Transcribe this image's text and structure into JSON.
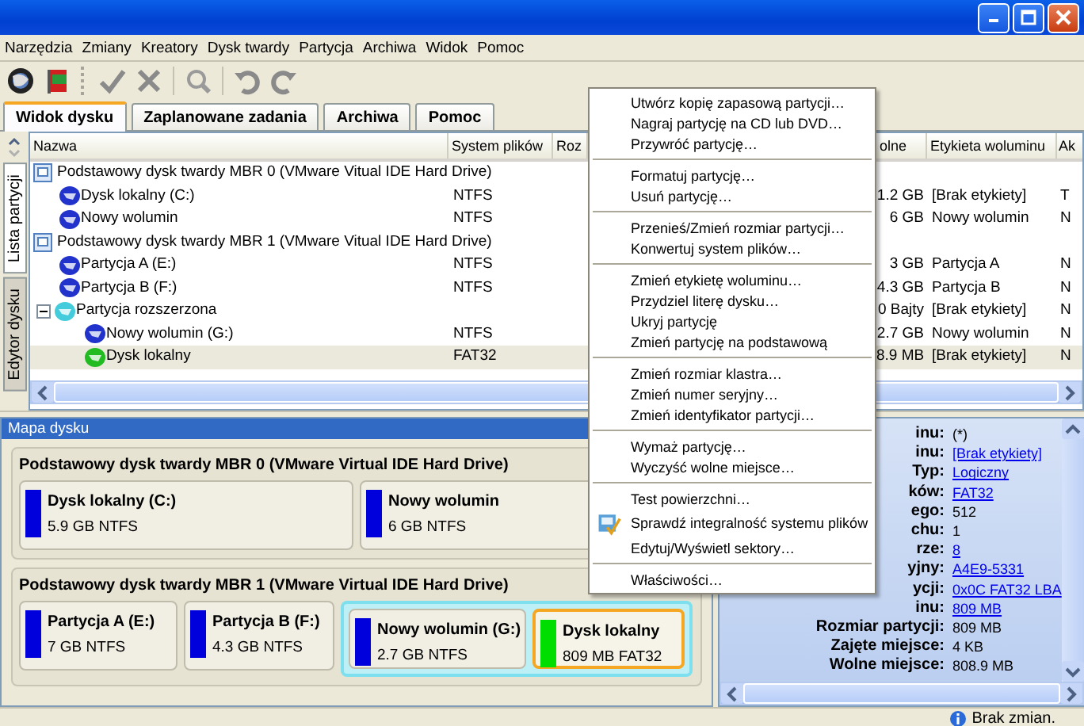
{
  "menu_bar": [
    "Narzędzia",
    "Zmiany",
    "Kreatory",
    "Dysk twardy",
    "Partycja",
    "Archiwa",
    "Widok",
    "Pomoc"
  ],
  "tabs": [
    {
      "label": "Widok dysku",
      "selected": true
    },
    {
      "label": "Zaplanowane zadania",
      "selected": false
    },
    {
      "label": "Archiwa",
      "selected": false
    },
    {
      "label": "Pomoc",
      "selected": false
    }
  ],
  "side_tabs": [
    {
      "label": "Lista partycji",
      "selected": true
    },
    {
      "label": "Edytor dysku",
      "selected": false
    }
  ],
  "table": {
    "columns": [
      "Nazwa",
      "System plików",
      "Roz",
      "olne",
      "Etykieta woluminu",
      "Ak"
    ],
    "rows": [
      {
        "kind": "disk",
        "name": "Podstawowy dysk twardy MBR 0 (VMware Vitual IDE Hard Drive)",
        "selected": false,
        "children": [
          {
            "kind": "partition",
            "name": "Dysk lokalny (C:)",
            "fs": "NTFS",
            "free": "1.2 GB",
            "label": "[Brak etykiety]",
            "active": "T",
            "color": "#2233cc",
            "selected": false
          },
          {
            "kind": "partition",
            "name": "Nowy wolumin",
            "fs": "NTFS",
            "free": "6 GB",
            "label": "Nowy wolumin",
            "active": "N",
            "color": "#2233cc",
            "selected": false
          }
        ]
      },
      {
        "kind": "disk",
        "name": "Podstawowy dysk twardy MBR 1 (VMware Vitual IDE Hard Drive)",
        "selected": false,
        "children": [
          {
            "kind": "partition",
            "name": "Partycja A (E:)",
            "fs": "NTFS",
            "free": "3 GB",
            "label": "Partycja A",
            "active": "N",
            "color": "#2233cc",
            "selected": false
          },
          {
            "kind": "partition",
            "name": "Partycja B (F:)",
            "fs": "NTFS",
            "free": "4.3 GB",
            "label": "Partycja B",
            "active": "N",
            "color": "#2233cc",
            "selected": false
          },
          {
            "kind": "partition",
            "name": "Partycja rozszerzona",
            "free": "0 Bajty",
            "label": "[Brak etykiety]",
            "active": "N",
            "color": "#44ccdd",
            "selected": false,
            "expanded": true,
            "children": [
              {
                "kind": "partition",
                "name": "Nowy wolumin (G:)",
                "fs": "NTFS",
                "free": "2.7 GB",
                "label": "Nowy wolumin",
                "active": "N",
                "color": "#2233cc",
                "selected": false
              },
              {
                "kind": "partition",
                "name": "Dysk lokalny",
                "fs": "FAT32",
                "free": "8.9 MB",
                "label": "[Brak etykiety]",
                "active": "N",
                "color": "#22bb22",
                "selected": true
              }
            ]
          }
        ]
      }
    ]
  },
  "disk_map": {
    "title": "Mapa dysku",
    "disks": [
      {
        "title": "Podstawowy dysk twardy MBR 0 (VMware Virtual IDE Hard Drive)",
        "partitions": [
          {
            "kind": "partition",
            "name": "Dysk lokalny (C:)",
            "info": "5.9 GB NTFS",
            "color": "#0000dd",
            "selected": false
          },
          {
            "kind": "partition",
            "name": "Nowy wolumin",
            "info": "6 GB NTFS",
            "color": "#0000dd",
            "selected": false
          }
        ]
      },
      {
        "title": "Podstawowy dysk twardy MBR 1 (VMware Virtual IDE Hard Drive)",
        "partitions": [
          {
            "kind": "partition",
            "name": "Partycja A (E:)",
            "info": "7 GB NTFS",
            "color": "#0000dd",
            "selected": false
          },
          {
            "kind": "partition",
            "name": "Partycja B (F:)",
            "info": "4.3 GB NTFS",
            "color": "#0000dd",
            "selected": false
          },
          {
            "kind": "extended",
            "partitions": [
              {
                "kind": "partition",
                "name": "Nowy wolumin (G:)",
                "info": "2.7 GB NTFS",
                "color": "#0000dd",
                "selected": false
              },
              {
                "kind": "partition",
                "name": "Dysk lokalny",
                "info": "809 MB FAT32",
                "color": "#00dd00",
                "selected": true
              }
            ]
          }
        ]
      }
    ]
  },
  "details": [
    {
      "label": "inu:",
      "value": "(*)",
      "link": false
    },
    {
      "label": "inu:",
      "value": "[Brak etykiety]",
      "link": true
    },
    {
      "label": "Typ:",
      "value": "Logiczny",
      "link": true
    },
    {
      "label": "ków:",
      "value": "FAT32",
      "link": true
    },
    {
      "label": "ego:",
      "value": "512",
      "link": false
    },
    {
      "label": "chu:",
      "value": "1",
      "link": false
    },
    {
      "label": "rze:",
      "value": "8",
      "link": true
    },
    {
      "label": "yjny:",
      "value": "A4E9-5331",
      "link": true
    },
    {
      "label": "ycji:",
      "value": "0x0C FAT32 LBA",
      "link": true
    },
    {
      "label": "inu:",
      "value": "809 MB",
      "link": true
    },
    {
      "label": "Rozmiar partycji:",
      "value": "809 MB",
      "link": false
    },
    {
      "label": "Zajęte miejsce:",
      "value": "4 KB",
      "link": false
    },
    {
      "label": "Wolne miejsce:",
      "value": "808.9 MB",
      "link": false
    }
  ],
  "context_menu": {
    "groups": [
      [
        {
          "kind": "plain",
          "label": "Utwórz kopię zapasową partycji…"
        },
        {
          "kind": "plain",
          "label": "Nagraj partycję na CD lub DVD…"
        },
        {
          "kind": "plain",
          "label": "Przywróć partycję…"
        }
      ],
      [
        {
          "kind": "plain",
          "label": "Formatuj partycję…"
        },
        {
          "kind": "plain",
          "label": "Usuń partycję…"
        }
      ],
      [
        {
          "kind": "plain",
          "label": "Przenieś/Zmień rozmiar partycji…"
        },
        {
          "kind": "plain",
          "label": "Konwertuj system plików…"
        }
      ],
      [
        {
          "kind": "plain",
          "label": "Zmień etykietę woluminu…"
        },
        {
          "kind": "plain",
          "label": "Przydziel literę dysku…"
        },
        {
          "kind": "plain",
          "label": "Ukryj partycję"
        },
        {
          "kind": "plain",
          "label": "Zmień partycję na podstawową"
        }
      ],
      [
        {
          "kind": "plain",
          "label": "Zmień rozmiar klastra…"
        },
        {
          "kind": "plain",
          "label": "Zmień numer seryjny…"
        },
        {
          "kind": "plain",
          "label": "Zmień identyfikator partycji…"
        }
      ],
      [
        {
          "kind": "plain",
          "label": "Wymaż partycję…"
        },
        {
          "kind": "plain",
          "label": "Wyczyść wolne miejsce…"
        }
      ],
      [
        {
          "kind": "plain",
          "label": "Test powierzchni…"
        },
        {
          "kind": "with-icon",
          "label": "Sprawdź integralność systemu plików"
        },
        {
          "kind": "plain",
          "label": "Edytuj/Wyświetl sektory…"
        }
      ],
      [
        {
          "kind": "plain",
          "label": "Właściwości…"
        }
      ]
    ]
  },
  "status_bar": {
    "text": "Brak zmian."
  }
}
